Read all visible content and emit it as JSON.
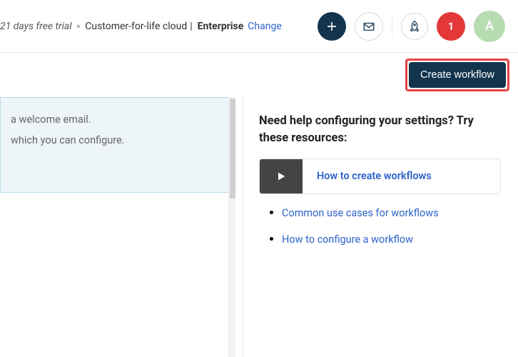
{
  "topbar": {
    "trial_text": "21 days free trial",
    "cloud_name": "Customer-for-life cloud",
    "plan": "Enterprise",
    "change_label": "Change",
    "notification_count": "1",
    "avatar_initial": "A"
  },
  "actions": {
    "create_workflow_label": "Create workflow"
  },
  "info_panel": {
    "line1": "a welcome email.",
    "line2": "which you can configure."
  },
  "help": {
    "title": "Need help configuring your settings? Try these resources:",
    "video_title": "How to create workflows",
    "links": [
      "Common use cases for workflows",
      "How to configure a workflow"
    ]
  }
}
